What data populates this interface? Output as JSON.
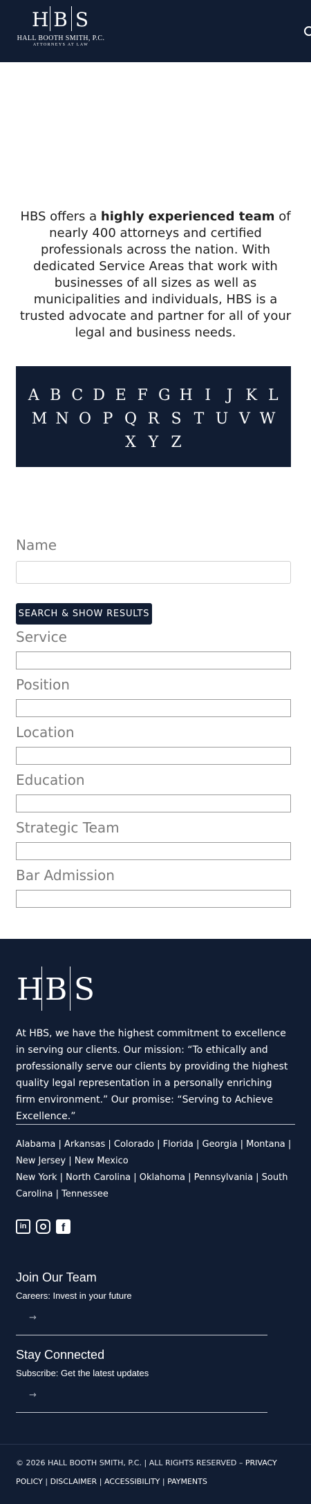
{
  "header": {
    "logo_letters": [
      "H",
      "B",
      "S"
    ],
    "logo_name": "HALL BOOTH SMITH, P.C.",
    "logo_sub": "ATTORNEYS AT LAW",
    "search_icon": "search-icon"
  },
  "intro": {
    "part1": "HBS offers a ",
    "bold": "highly experienced team",
    "part2": " of nearly 400 attorneys and certified professionals across the nation. With dedicated Service Areas that work with businesses of all sizes as well as municipalities and individuals, HBS is a trusted advocate and partner for all of your legal and business needs."
  },
  "alphabet": {
    "row1": [
      "A",
      "B",
      "C",
      "D",
      "E",
      "F",
      "G",
      "H",
      "I",
      "J",
      "K",
      "L"
    ],
    "row2": [
      "M",
      "N",
      "O",
      "P",
      "Q",
      "R",
      "S",
      "T",
      "U",
      "V",
      "W"
    ],
    "row3": [
      "X",
      "Y",
      "Z"
    ]
  },
  "form": {
    "name_label": "Name",
    "search_button": "SEARCH & SHOW RESULTS",
    "service_label": "Service",
    "position_label": "Position",
    "location_label": "Location",
    "education_label": "Education",
    "strategic_team_label": "Strategic Team",
    "bar_admission_label": "Bar Admission"
  },
  "footer": {
    "logo_letters": [
      "H",
      "B",
      "S"
    ],
    "mission": "At HBS, we have the highest commitment to excellence in serving our clients. Our mission: “To ethically and professionally serve our clients by providing the highest quality legal representation in a personally enriching firm environment.” Our promise: “Serving to Achieve Excellence.”",
    "states_line1": "Alabama | Arkansas | Colorado | Florida | Georgia | Montana | New Jersey | New Mexico",
    "states_line2": "New York | North Carolina | Oklahoma | Pennsylvania | South Carolina | Tennessee",
    "social": {
      "linkedin": "in",
      "instagram": "",
      "facebook": "f"
    },
    "join_heading": "Join Our Team",
    "join_sub": "Careers: Invest in your future",
    "connect_heading": "Stay Connected",
    "connect_sub": "Subscribe: Get the latest updates",
    "arrow": "→",
    "copyright": "© 2026 HALL BOOTH SMITH, P.C. | ALL RIGHTS RESERVED –",
    "privacy": "PRIVACY POLICY",
    "disclaimer": "DISCLAIMER",
    "accessibility": "ACCESSIBILITY",
    "payments": "PAYMENTS",
    "sep": "|"
  },
  "colors": {
    "navy": "#111d33",
    "white": "#ffffff",
    "label_gray": "#7a7a7a"
  }
}
